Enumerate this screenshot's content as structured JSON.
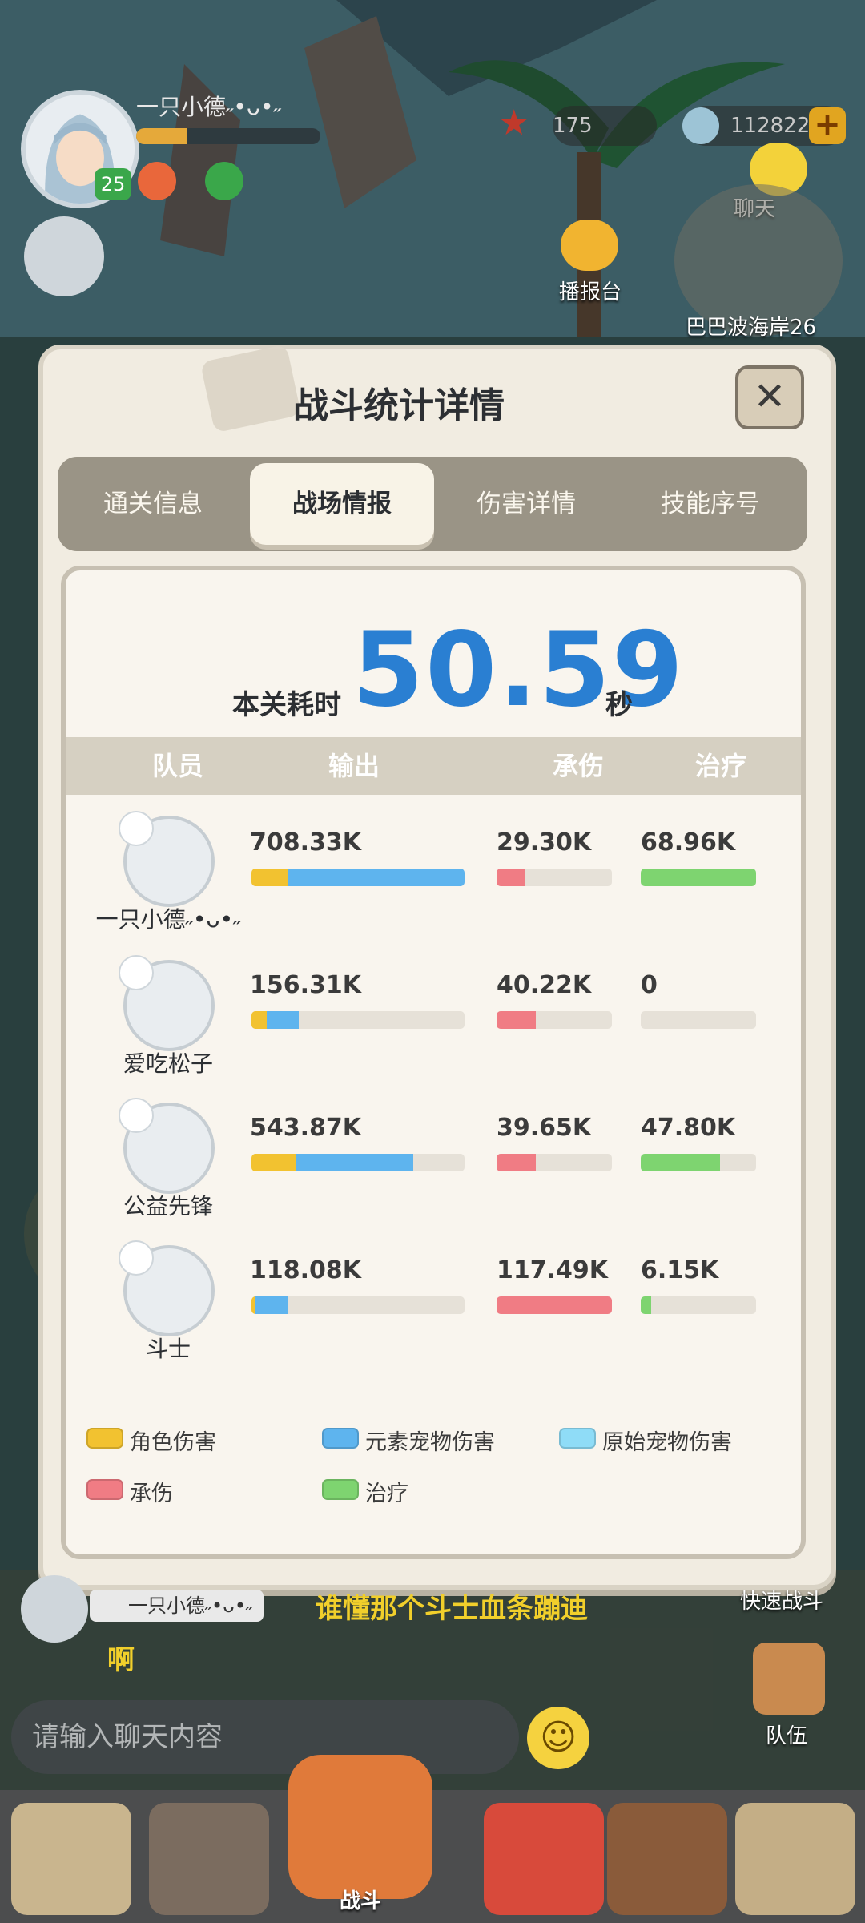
{
  "hud": {
    "player_name": "一只小德˶•ᴗ•˶",
    "level": "25",
    "xp_fraction": 0.28,
    "starfish_count": "175",
    "shell_count": "112822",
    "plus_symbol": "+",
    "chat_label": "聊天",
    "broadcast_label": "播报台",
    "location_label": "巴巴波海岸26"
  },
  "modal": {
    "title": "战斗统计详情",
    "close_symbol": "✕",
    "tabs": [
      "通关信息",
      "战场情报",
      "伤害详情",
      "技能序号"
    ],
    "active_tab": 1,
    "time_label": "本关耗时",
    "time_value": "50.59",
    "time_unit": "秒",
    "columns": [
      "队员",
      "输出",
      "承伤",
      "治疗"
    ],
    "members": [
      {
        "name": "一只小德˶•ᴗ•˶",
        "class": "water",
        "output": "708.33K",
        "taken": "29.30K",
        "heal": "68.96K",
        "out_role": 0.17,
        "out_elem": 0.83,
        "out_orig": 0,
        "taken_frac": 0.25,
        "heal_frac": 1.0
      },
      {
        "name": "爱吃松子",
        "class": "fire",
        "output": "156.31K",
        "taken": "40.22K",
        "heal": "0",
        "out_role": 0.07,
        "out_elem": 0.15,
        "out_orig": 0,
        "taken_frac": 0.34,
        "heal_frac": 0
      },
      {
        "name": "公益先锋",
        "class": "water",
        "output": "543.87K",
        "taken": "39.65K",
        "heal": "47.80K",
        "out_role": 0.21,
        "out_elem": 0.55,
        "out_orig": 0,
        "taken_frac": 0.34,
        "heal_frac": 0.69
      },
      {
        "name": "斗士",
        "class": "warrior",
        "output": "118.08K",
        "taken": "117.49K",
        "heal": "6.15K",
        "out_role": 0.02,
        "out_elem": 0.15,
        "out_orig": 0,
        "taken_frac": 1.0,
        "heal_frac": 0.09
      }
    ],
    "legend": [
      {
        "label": "角色伤害",
        "color": "#f2c230"
      },
      {
        "label": "元素宠物伤害",
        "color": "#5eb4ee"
      },
      {
        "label": "原始宠物伤害",
        "color": "#8fdcf7"
      },
      {
        "label": "承伤",
        "color": "#f07c84"
      },
      {
        "label": "治疗",
        "color": "#7ed470"
      }
    ]
  },
  "chat": {
    "sender": "一只小德˶•ᴗ•˶",
    "line1": "谁懂那个斗士血条蹦迪",
    "line2": "啊",
    "placeholder": "请输入聊天内容",
    "quick_battle": "快速战斗",
    "team": "队伍",
    "emoji": "☺"
  },
  "bottom_nav": {
    "battle_label": "战斗"
  },
  "colors": {
    "accent_blue": "#2a7fd2",
    "role": "#f2c230",
    "elem": "#5eb4ee",
    "taken": "#f07c84",
    "heal": "#7ed470"
  }
}
